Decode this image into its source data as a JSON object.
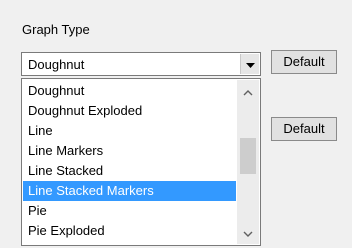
{
  "section_label": "Graph Type",
  "combo": {
    "selected_value": "Doughnut"
  },
  "buttons": {
    "default_1": "Default",
    "default_2": "Default"
  },
  "dropdown": {
    "items": [
      {
        "label": "Doughnut",
        "selected": false
      },
      {
        "label": "Doughnut Exploded",
        "selected": false
      },
      {
        "label": "Line",
        "selected": false
      },
      {
        "label": "Line Markers",
        "selected": false
      },
      {
        "label": "Line Stacked",
        "selected": false
      },
      {
        "label": "Line Stacked Markers",
        "selected": true
      },
      {
        "label": "Pie",
        "selected": false
      },
      {
        "label": "Pie Exploded",
        "selected": false
      }
    ]
  },
  "icons": {
    "combo_arrow": "chevron-down-icon",
    "scroll_up": "chevron-up-icon",
    "scroll_down": "chevron-down-icon"
  },
  "colors": {
    "selection_bg": "#3399ff",
    "selection_text": "#ffffff",
    "window_bg": "#f0f0f0"
  }
}
